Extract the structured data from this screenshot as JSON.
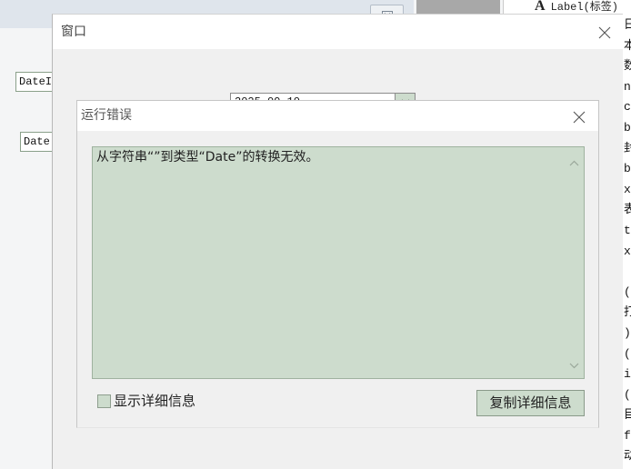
{
  "background": {
    "toolbar_button_icon": "x-box-icon",
    "designer_labels": [
      "DateI",
      "Date"
    ],
    "properties_panel": {
      "icon_letter": "A",
      "title": "Label(标签)",
      "clipped_lines": [
        "日",
        "本",
        "数",
        "n",
        "c",
        "b",
        "封",
        "b",
        "x",
        "表",
        "t",
        "x",
        "(",
        "打",
        ")",
        "(",
        "i",
        "(",
        "目",
        "f",
        "动"
      ]
    }
  },
  "window": {
    "title": "窗口",
    "close_icon": "close-icon",
    "date_value": "2025-09-10",
    "date_dropdown_icon": "chevron-down-icon"
  },
  "error_dialog": {
    "title": "运行错误",
    "close_icon": "close-icon",
    "message": "从字符串“”到类型“Date”的转换无效。",
    "scroll_up_icon": "chevron-up-icon",
    "scroll_down_icon": "chevron-down-icon",
    "show_details_label": "显示详细信息",
    "show_details_checked": false,
    "copy_button_label": "复制详细信息"
  },
  "colors": {
    "sage_green": "#cddccd",
    "sage_border": "#9fb29f"
  }
}
